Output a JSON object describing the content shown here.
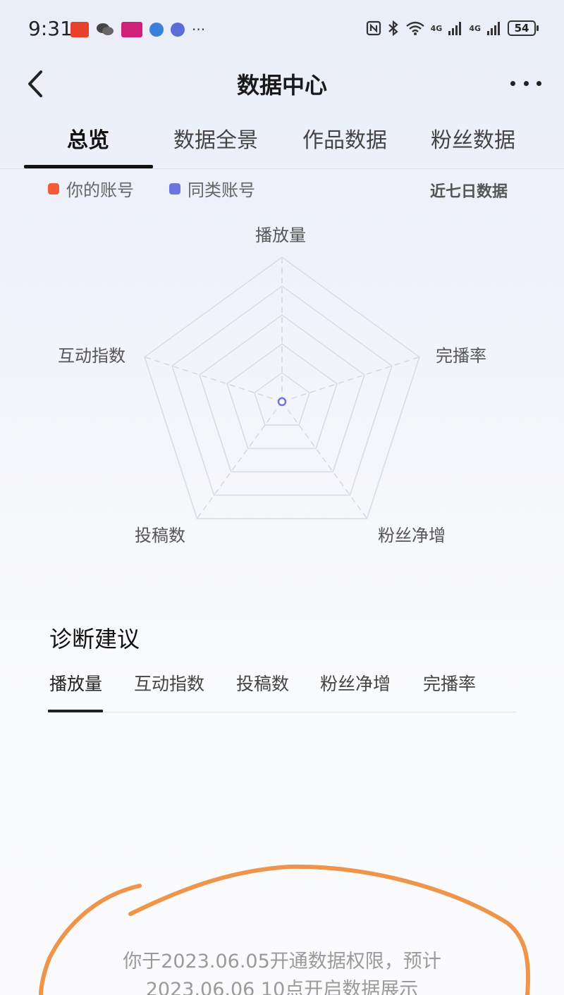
{
  "status_bar": {
    "time": "9:31",
    "network_a": "4G",
    "network_b": "4G",
    "battery": "54"
  },
  "header": {
    "title": "数据中心"
  },
  "tabs": [
    {
      "label": "总览"
    },
    {
      "label": "数据全景"
    },
    {
      "label": "作品数据"
    },
    {
      "label": "粉丝数据"
    }
  ],
  "legend": {
    "yours": "你的账号",
    "peer": "同类账号",
    "period": "近七日数据",
    "colors": {
      "yours": "#f25a3a",
      "peer": "#6f73e0"
    }
  },
  "radar": {
    "axes": [
      "播放量",
      "完播率",
      "粉丝净增",
      "投稿数",
      "互动指数"
    ]
  },
  "diagnosis": {
    "title": "诊断建议",
    "tabs": [
      "播放量",
      "互动指数",
      "投稿数",
      "粉丝净增",
      "完播率"
    ]
  },
  "notice": {
    "line1": "你于2023.06.05开通数据权限，预计",
    "line2": "2023.06.06 10点开启数据展示"
  }
}
